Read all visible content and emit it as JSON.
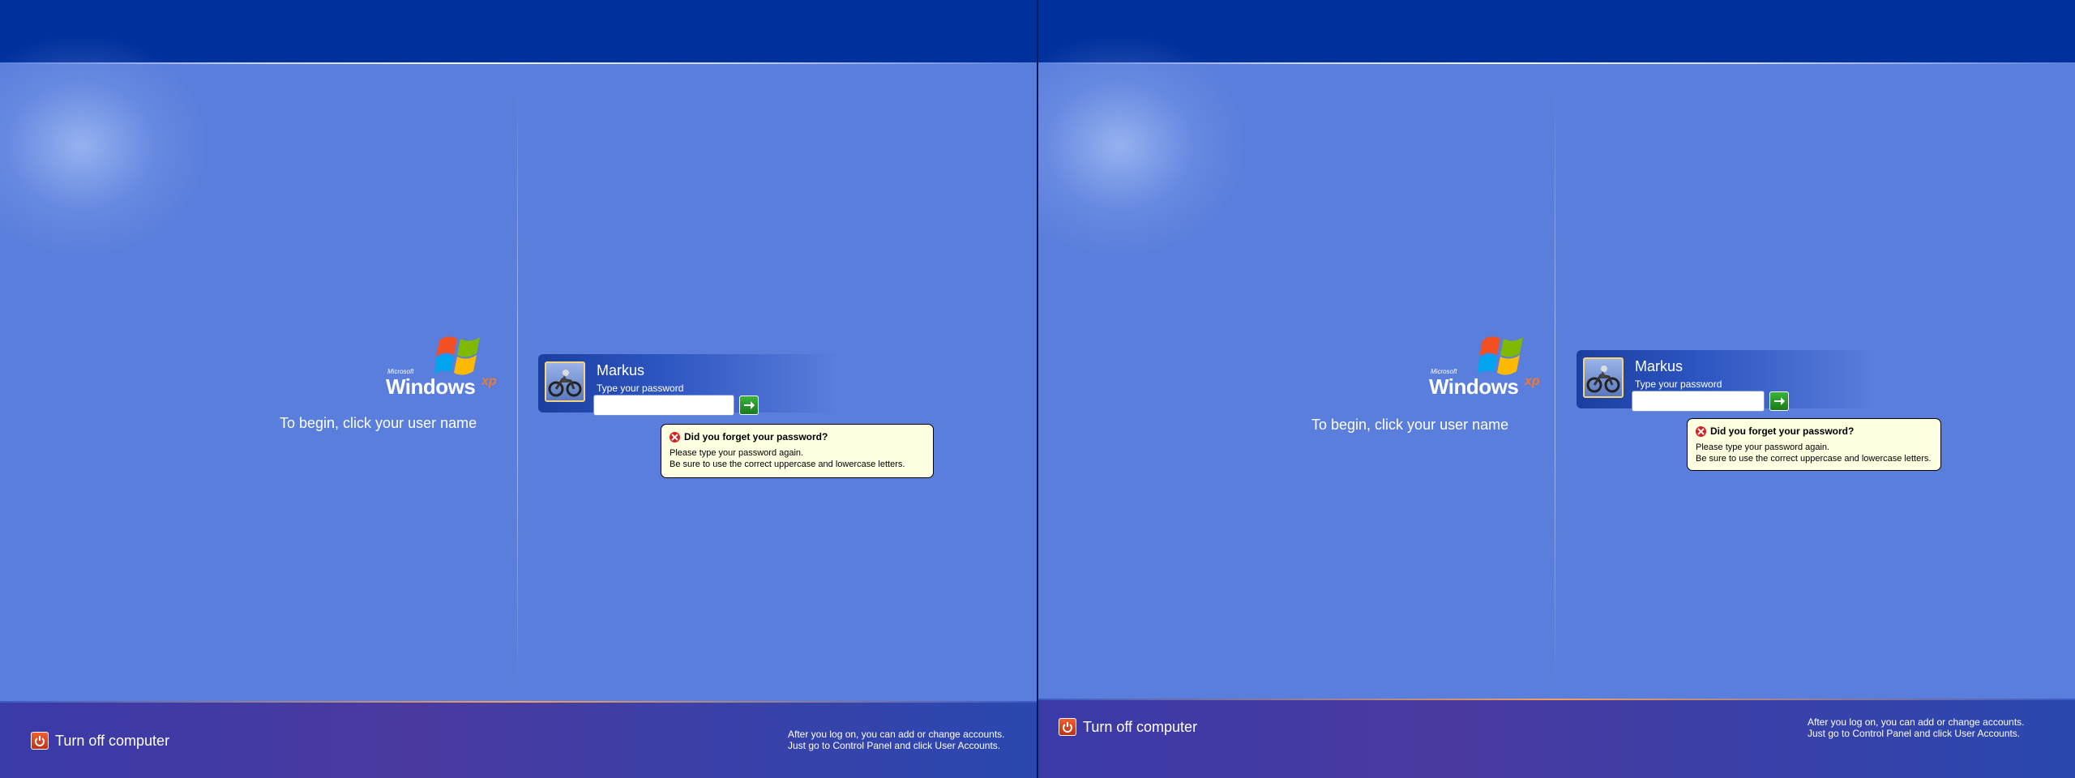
{
  "logo": {
    "microsoft": "Microsoft",
    "windows": "Windows",
    "xp": "xp"
  },
  "welcome": {
    "begin_text": "To begin, click your user name"
  },
  "user": {
    "name": "Markus",
    "prompt": "Type your password",
    "password_value": ""
  },
  "balloon": {
    "title": "Did you forget your password?",
    "line1": "Please type your password again.",
    "line2": "Be sure to use the correct uppercase and lowercase letters."
  },
  "footer": {
    "turn_off_label": "Turn off computer",
    "hint_line1": "After you log on, you can add or change accounts.",
    "hint_line2": "Just go to Control Panel and click User Accounts."
  },
  "colors": {
    "background": "#5a7edc",
    "top_bar": "#00309c",
    "bottom_bar": "#3a3aa8",
    "balloon_bg": "#ffffe1",
    "go_button": "#2a9a2a",
    "turn_off_icon": "#e04820"
  },
  "icons": {
    "turn_off": "power-icon",
    "go": "arrow-right-icon",
    "error": "error-x-icon",
    "avatar": "motorcycle-avatar"
  }
}
